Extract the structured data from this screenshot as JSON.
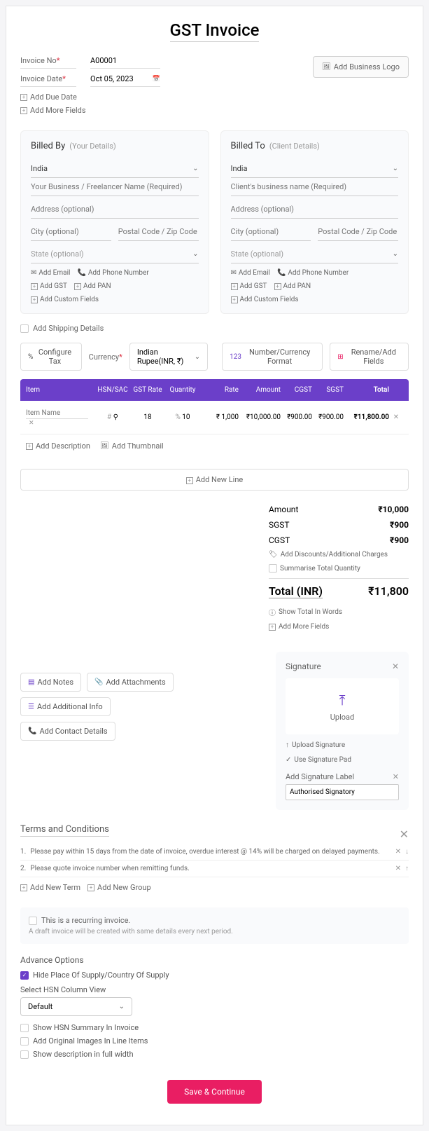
{
  "title": "GST Invoice",
  "meta": {
    "invoiceNoLabel": "Invoice No",
    "invoiceNo": "A00001",
    "invoiceDateLabel": "Invoice Date",
    "invoiceDate": "Oct 05, 2023",
    "addDueDate": "Add Due Date",
    "addMoreFields": "Add More Fields"
  },
  "logoBtn": "Add Business Logo",
  "billedBy": {
    "title": "Billed By",
    "sub": "(Your Details)",
    "country": "India",
    "namePh": "Your Business / Freelancer Name (Required)",
    "addressPh": "Address (optional)",
    "cityPh": "City (optional)",
    "zipPh": "Postal Code / Zip Code",
    "statePh": "State (optional)",
    "addEmail": "Add Email",
    "addPhone": "Add Phone Number",
    "addGst": "Add GST",
    "addPan": "Add PAN",
    "addCustom": "Add Custom Fields"
  },
  "billedTo": {
    "title": "Billed To",
    "sub": "(Client Details)",
    "country": "India",
    "namePh": "Client's business name (Required)",
    "addressPh": "Address (optional)",
    "cityPh": "City (optional)",
    "zipPh": "Postal Code / Zip Code",
    "statePh": "State (optional)",
    "addEmail": "Add Email",
    "addPhone": "Add Phone Number",
    "addGst": "Add GST",
    "addPan": "Add PAN",
    "addCustom": "Add Custom Fields"
  },
  "shipping": "Add Shipping Details",
  "config": {
    "configTax": "Configure Tax",
    "currencyLabel": "Currency",
    "currency": "Indian Rupee(INR, ₹)",
    "numFormat": "Number/Currency Format",
    "rename": "Rename/Add Fields"
  },
  "table": {
    "headers": {
      "item": "Item",
      "hsn": "HSN/SAC",
      "gstRate": "GST Rate",
      "qty": "Quantity",
      "rate": "Rate",
      "amount": "Amount",
      "cgst": "CGST",
      "sgst": "SGST",
      "total": "Total"
    },
    "row": {
      "itemPh": "Item Name",
      "hsn": "#",
      "search": "⚲",
      "gstRate": "18",
      "qty": "10",
      "rate": "₹ 1,000",
      "amount": "₹10,000.00",
      "cgst": "₹900.00",
      "sgst": "₹900.00",
      "total": "₹11,800.00"
    },
    "addDesc": "Add Description",
    "addThumb": "Add Thumbnail",
    "addLine": "Add New Line"
  },
  "totals": {
    "amountLabel": "Amount",
    "amount": "₹10,000",
    "sgstLabel": "SGST",
    "sgst": "₹900",
    "cgstLabel": "CGST",
    "cgst": "₹900",
    "addDisc": "Add Discounts/Additional Charges",
    "sumQty": "Summarise Total Quantity",
    "totalLabel": "Total (INR)",
    "total": "₹11,800",
    "showWords": "Show Total In Words",
    "addMore": "Add More Fields"
  },
  "actions": {
    "addNotes": "Add Notes",
    "addAttach": "Add Attachments",
    "addInfo": "Add Additional Info",
    "addContact": "Add Contact Details"
  },
  "signature": {
    "title": "Signature",
    "upload": "Upload",
    "uploadSig": "Upload Signature",
    "usePad": "Use Signature Pad",
    "addLabel": "Add Signature Label",
    "auth": "Authorised Signatory"
  },
  "terms": {
    "title": "Terms and Conditions",
    "t1n": "1.",
    "t1": "Please pay within 15 days from the date of invoice, overdue interest @ 14% will be charged on delayed payments.",
    "t2n": "2.",
    "t2": "Please quote invoice number when remitting funds.",
    "addTerm": "Add New Term",
    "addGroup": "Add New Group"
  },
  "recurring": {
    "label": "This is a recurring invoice.",
    "sub": "A draft invoice will be created with same details every next period."
  },
  "advance": {
    "title": "Advance Options",
    "hidePlace": "Hide Place Of Supply/Country Of Supply",
    "selectHsn": "Select HSN Column View",
    "default": "Default",
    "showHsn": "Show HSN Summary In Invoice",
    "addImg": "Add Original Images In Line Items",
    "showDesc": "Show description in full width"
  },
  "save": "Save & Continue"
}
